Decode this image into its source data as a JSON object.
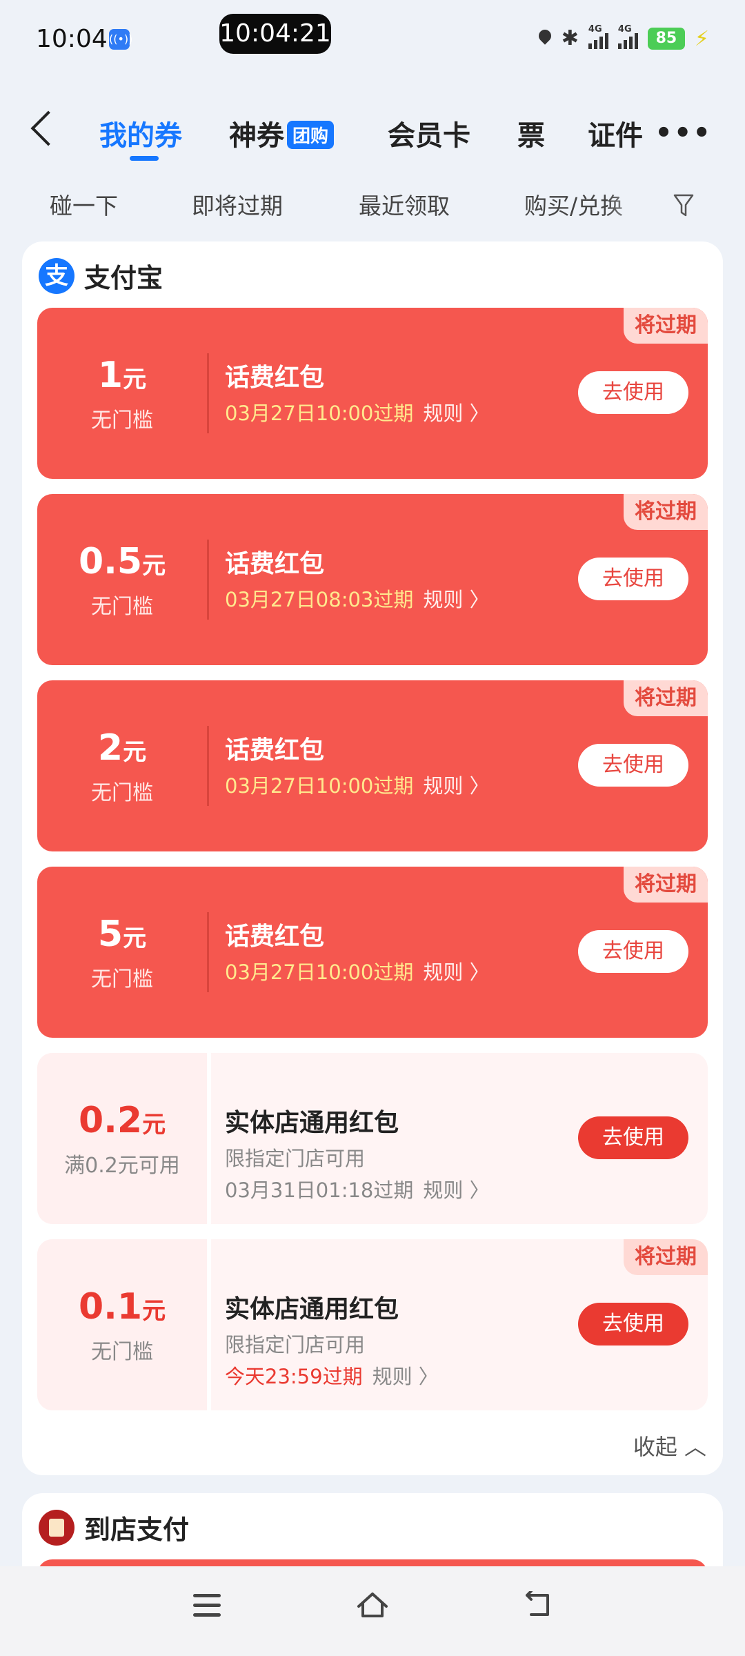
{
  "status_bar": {
    "time": "10:04",
    "pill_time": "10:04:21",
    "nfc_icon": "((•))",
    "bluetooth_icon": "✱",
    "sim1": "4G",
    "sim2": "4G",
    "battery": "85",
    "charging_icon": "⚡"
  },
  "tabs": [
    {
      "label": "我的券",
      "active": true
    },
    {
      "label": "神券",
      "badge": "团购"
    },
    {
      "label": "会员卡"
    },
    {
      "label": "票"
    },
    {
      "label": "证件"
    }
  ],
  "more_label": "•••",
  "filters": [
    "碰一下",
    "即将过期",
    "最近领取",
    "购买/兑换"
  ],
  "alipay_section": {
    "logo": "支",
    "title": "支付宝",
    "collapse_label": "收起 ︿",
    "coupons": [
      {
        "amount": "1",
        "unit": "元",
        "condition": "无门槛",
        "name": "话费红包",
        "expire": "03月27日10:00过期",
        "rule": "规则 〉",
        "button": "去使用",
        "badge": "将过期"
      },
      {
        "amount": "0.5",
        "unit": "元",
        "condition": "无门槛",
        "name": "话费红包",
        "expire": "03月27日08:03过期",
        "rule": "规则 〉",
        "button": "去使用",
        "badge": "将过期"
      },
      {
        "amount": "2",
        "unit": "元",
        "condition": "无门槛",
        "name": "话费红包",
        "expire": "03月27日10:00过期",
        "rule": "规则 〉",
        "button": "去使用",
        "badge": "将过期"
      },
      {
        "amount": "5",
        "unit": "元",
        "condition": "无门槛",
        "name": "话费红包",
        "expire": "03月27日10:00过期",
        "rule": "规则 〉",
        "button": "去使用",
        "badge": "将过期"
      },
      {
        "amount": "0.2",
        "unit": "元",
        "condition": "满0.2元可用",
        "name": "实体店通用红包",
        "note": "限指定门店可用",
        "expire": "03月31日01:18过期",
        "rule": "规则 〉",
        "button": "去使用"
      },
      {
        "amount": "0.1",
        "unit": "元",
        "condition": "无门槛",
        "name": "实体店通用红包",
        "note": "限指定门店可用",
        "expire": "今天23:59过期",
        "rule": "规则 〉",
        "button": "去使用",
        "badge": "将过期"
      }
    ]
  },
  "store_section": {
    "title": "到店支付"
  },
  "colors": {
    "accent": "#1677ff",
    "coupon_red": "#f5574f",
    "button_red": "#ea3a31",
    "expire_yellow": "#ffe98e"
  }
}
